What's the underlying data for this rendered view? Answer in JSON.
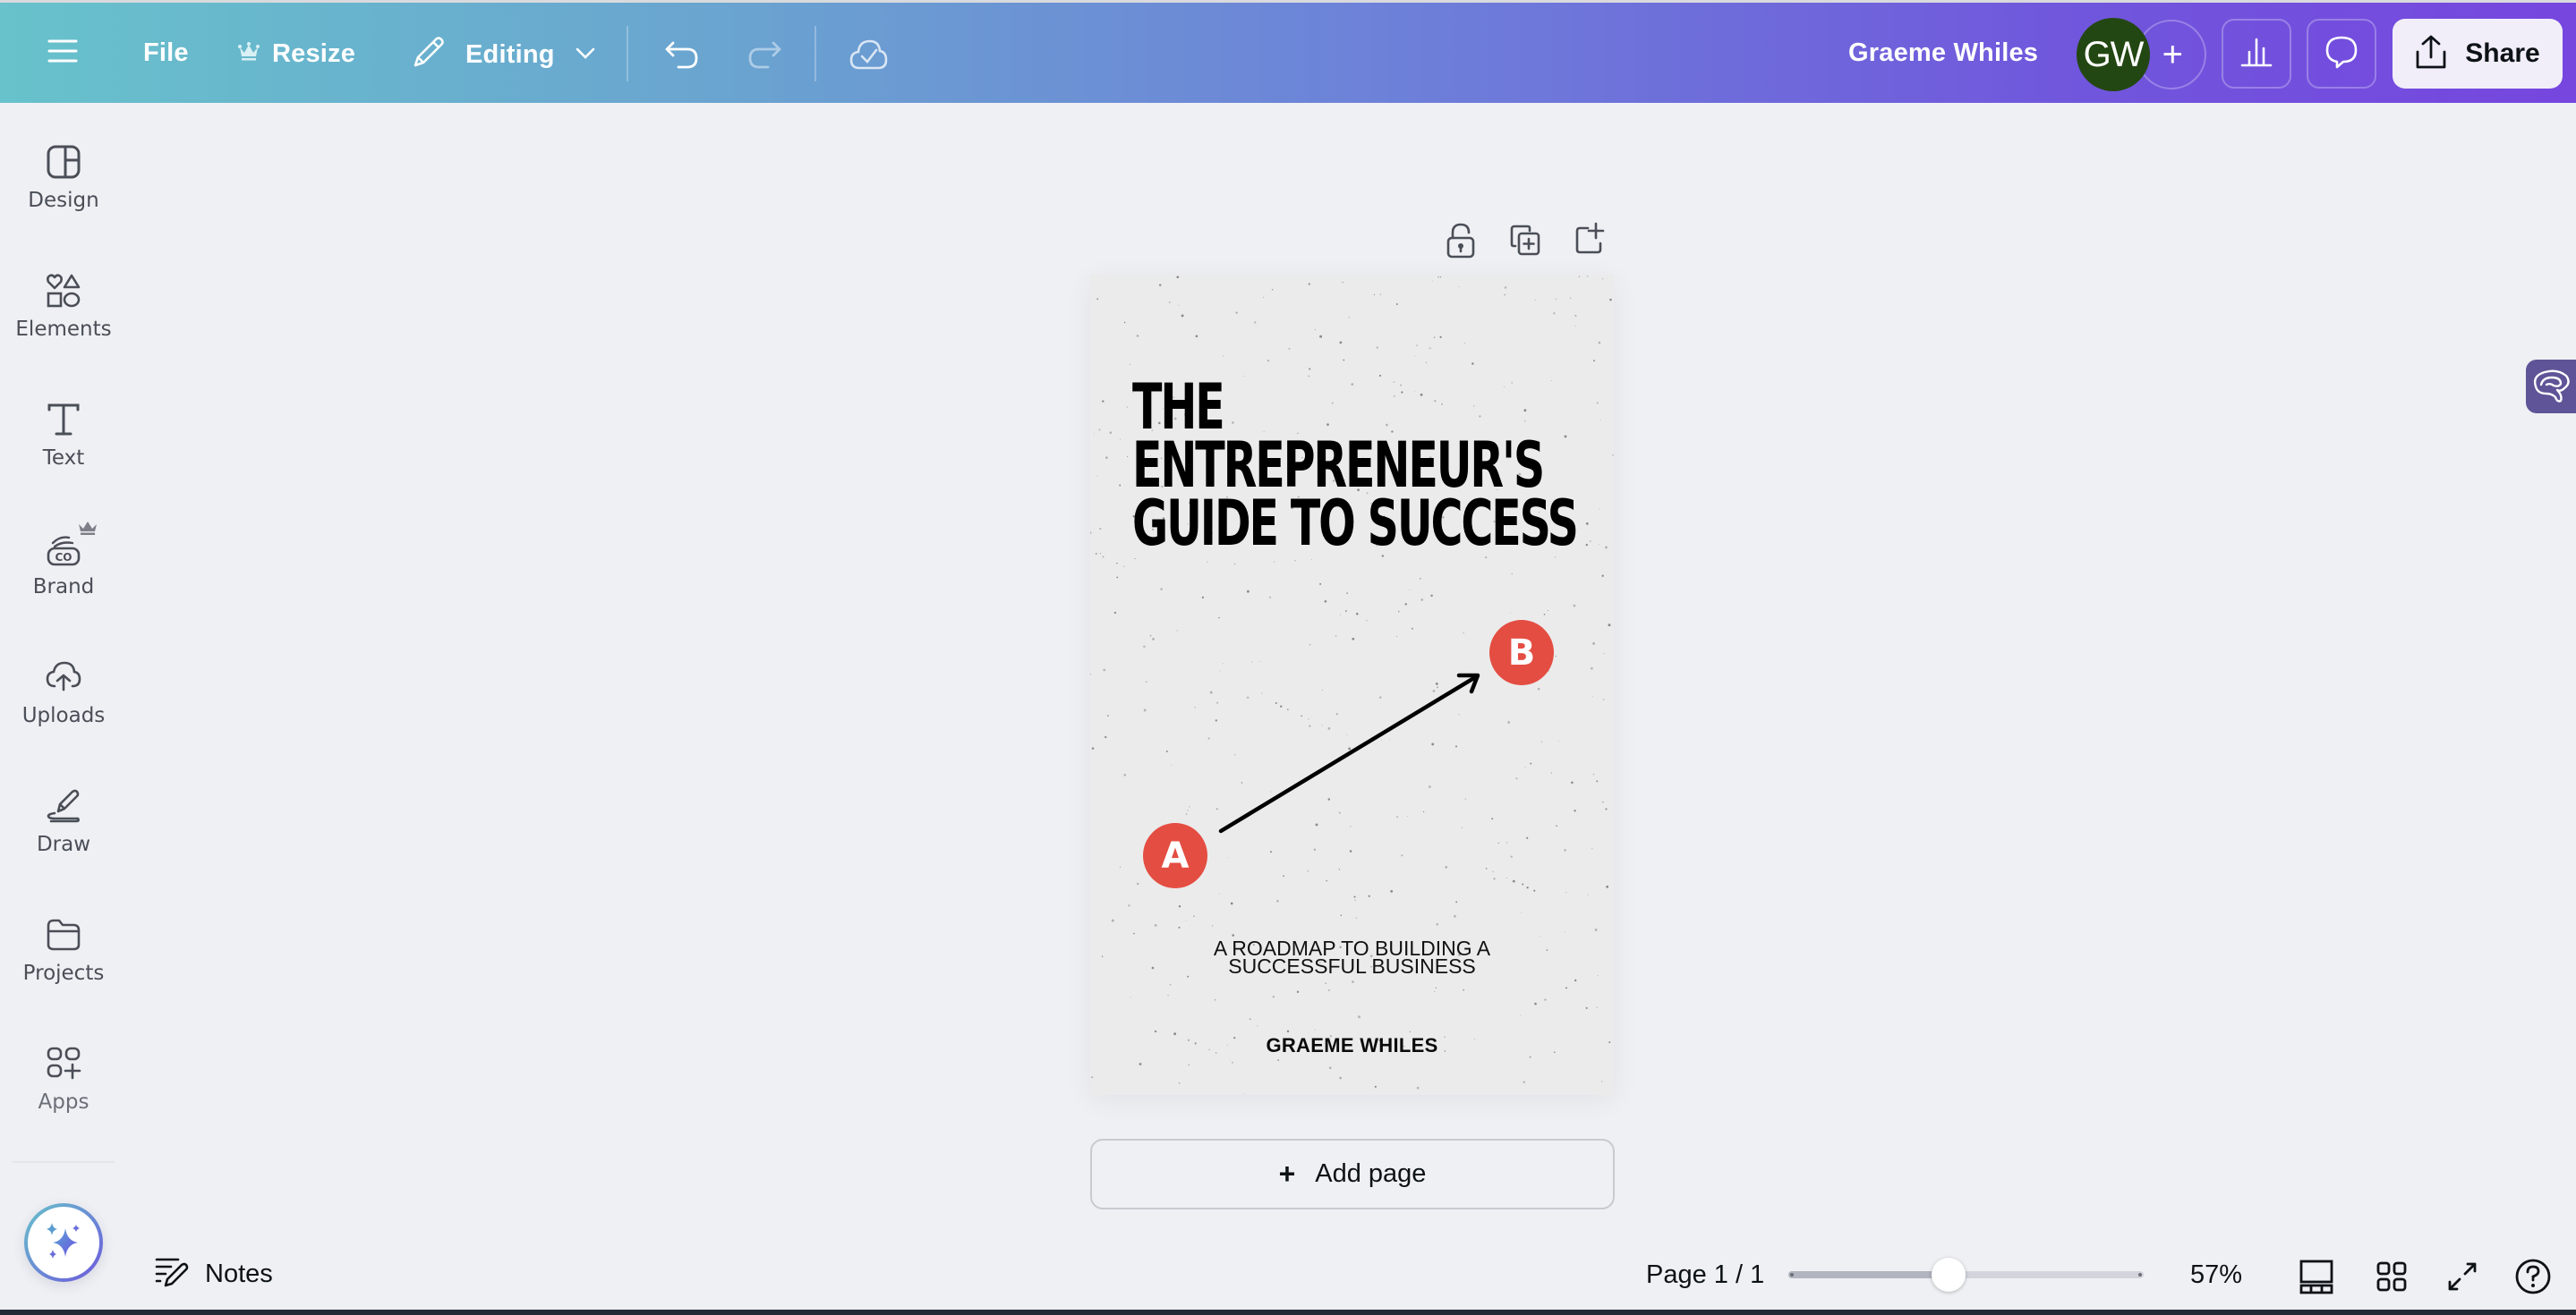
{
  "header": {
    "menu_icon": "hamburger-menu-icon",
    "file_label": "File",
    "resize_label": "Resize",
    "resize_badge_icon": "crown-icon",
    "mode_label": "Editing",
    "mode_icon": "pencil-icon",
    "undo_icon": "undo-icon",
    "redo_icon": "redo-icon",
    "save_status_icon": "cloud-check-icon",
    "user_name": "Graeme Whiles",
    "avatar_initials": "GW",
    "avatar_color": "#234712",
    "add_collaborator_label": "+",
    "analytics_icon": "bar-chart-icon",
    "comment_icon": "comment-icon",
    "share_label": "Share",
    "share_icon": "upload-icon"
  },
  "sidebar": {
    "items": [
      {
        "label": "Design",
        "icon": "layout-icon"
      },
      {
        "label": "Elements",
        "icon": "shapes-icon"
      },
      {
        "label": "Text",
        "icon": "text-icon"
      },
      {
        "label": "Brand",
        "icon": "brand-icon",
        "premium": true
      },
      {
        "label": "Uploads",
        "icon": "cloud-upload-icon"
      },
      {
        "label": "Draw",
        "icon": "draw-icon"
      },
      {
        "label": "Projects",
        "icon": "folder-icon"
      },
      {
        "label": "Apps",
        "icon": "apps-icon"
      }
    ],
    "magic_button_icon": "sparkle-icon"
  },
  "canvas": {
    "page_tools": [
      "lock-icon",
      "duplicate-page-icon",
      "add-page-icon"
    ],
    "page": {
      "title_lines": [
        "THE",
        "ENTREPRENEUR'S",
        "GUIDE TO SUCCESS"
      ],
      "subtitle_lines": [
        "A ROADMAP TO BUILDING A",
        "SUCCESSFUL BUSINESS"
      ],
      "author": "GRAEME WHILES",
      "markers": [
        {
          "label": "A",
          "color": "#e44d42"
        },
        {
          "label": "B",
          "color": "#e44d42"
        }
      ],
      "arrow_direction": "A-to-B"
    },
    "add_page_label": "Add page",
    "add_page_plus": "+"
  },
  "right_panel_tab_icon": "brain-icon",
  "bottom_bar": {
    "notes_label": "Notes",
    "notes_icon": "notes-icon",
    "page_indicator": "Page 1 / 1",
    "zoom_percent": "57%",
    "zoom_slider_fraction": 0.45,
    "view_icons": [
      "filmstrip-view-icon",
      "grid-view-icon",
      "fullscreen-icon",
      "help-icon"
    ]
  },
  "colors": {
    "accent_marker": "#e44d42",
    "page_background": "#ebebeb",
    "workspace_background": "#eff0f4"
  }
}
